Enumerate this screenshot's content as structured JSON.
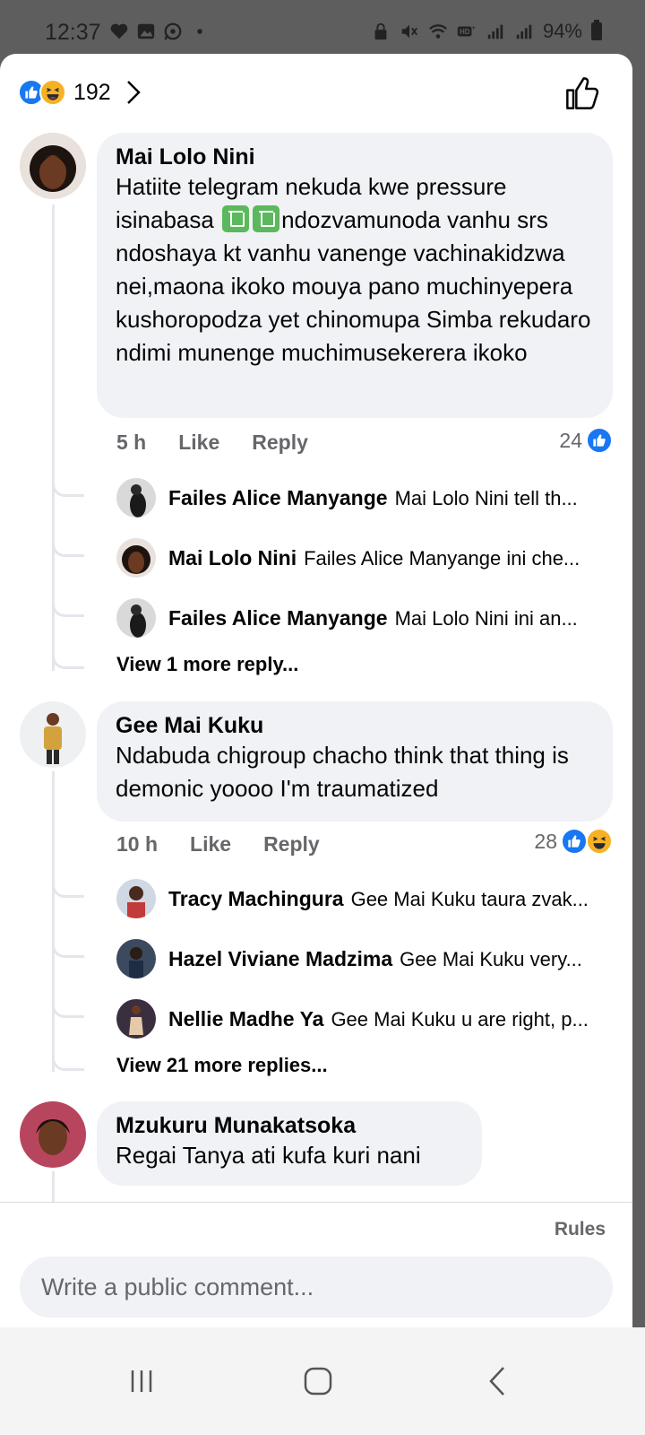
{
  "status_bar": {
    "time": "12:37",
    "battery": "94%"
  },
  "header": {
    "reaction_count": "192"
  },
  "comments": [
    {
      "author": "Mai Lolo Nini",
      "text_part1": "Hatiite telegram nekuda kwe pressure isinabasa ",
      "text_part2": "ndozvamunoda vanhu srs ndoshaya kt vanhu vanenge vachinakidzwa nei,maona ikoko mouya pano muchinyepera kushoropodza yet chinomupa Simba rekudaro ndimi munenge muchimusekerera ikoko",
      "time": "5 h",
      "like_label": "Like",
      "reply_label": "Reply",
      "reaction_count": "24",
      "replies": [
        {
          "author": "Failes Alice Manyange",
          "text": "Mai Lolo Nini tell th..."
        },
        {
          "author": "Mai Lolo Nini",
          "text": "Failes Alice Manyange ini che..."
        },
        {
          "author": "Failes Alice Manyange",
          "text": "Mai Lolo Nini ini an..."
        }
      ],
      "view_more": "View 1 more reply..."
    },
    {
      "author": "Gee Mai Kuku",
      "text": "Ndabuda chigroup chacho think that thing is demonic yoooo I'm traumatized",
      "time": "10 h",
      "like_label": "Like",
      "reply_label": "Reply",
      "reaction_count": "28",
      "replies": [
        {
          "author": "Tracy Machingura",
          "text": "Gee Mai Kuku taura zvak..."
        },
        {
          "author": "Hazel Viviane Madzima",
          "text": "Gee Mai Kuku very..."
        },
        {
          "author": "Nellie Madhe Ya",
          "text": "Gee Mai Kuku u are right, p..."
        }
      ],
      "view_more": "View 21 more replies..."
    },
    {
      "author": "Mzukuru Munakatsoka",
      "text": "Regai Tanya ati kufa kuri nani"
    }
  ],
  "footer": {
    "rules_label": "Rules",
    "input_placeholder": "Write a public comment..."
  },
  "colors": {
    "facebook_blue": "#1877f2",
    "bubble_gray": "#f0f2f5",
    "meta_gray": "#65676b"
  }
}
